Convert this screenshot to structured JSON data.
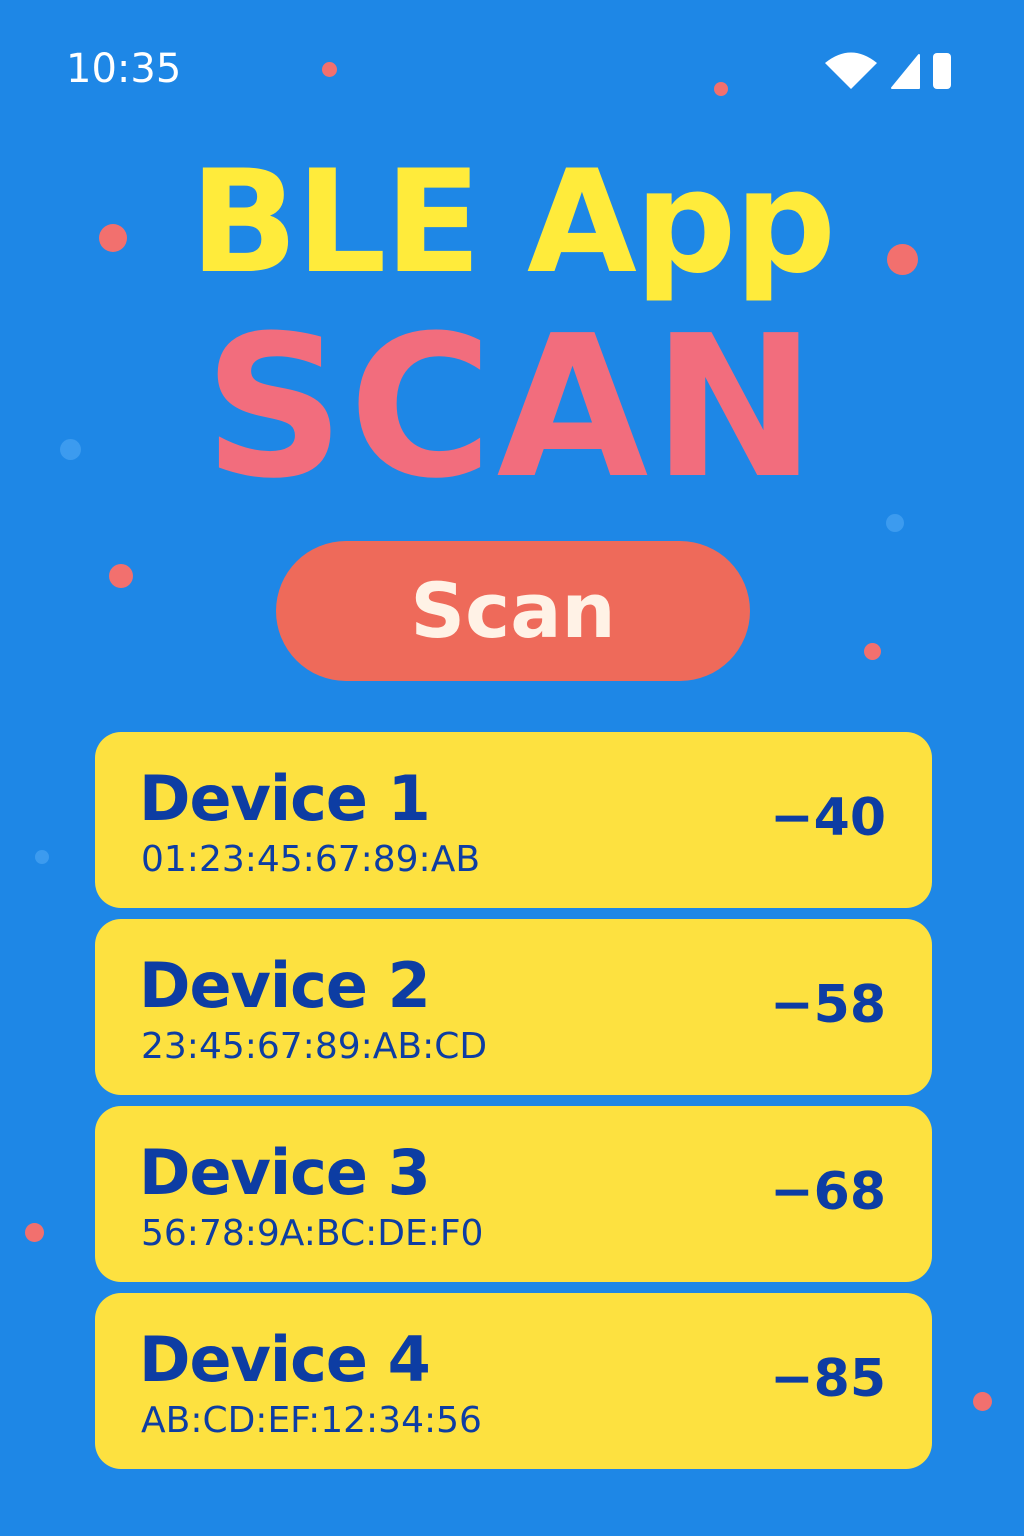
{
  "status_bar": {
    "time": "10:35",
    "icons": [
      "wifi-icon",
      "cellular-signal-icon",
      "battery-icon"
    ]
  },
  "header": {
    "app_title": "BLE App",
    "scan_title": "SCAN"
  },
  "scan_button": {
    "label": "Scan"
  },
  "devices": [
    {
      "name": "Device 1",
      "address": "01:23:45:67:89:AB",
      "rssi": "−40"
    },
    {
      "name": "Device 2",
      "address": "23:45:67:89:AB:CD",
      "rssi": "−58"
    },
    {
      "name": "Device 3",
      "address": "56:78:9A:BC:DE:F0",
      "rssi": "−68"
    },
    {
      "name": "Device 4",
      "address": "AB:CD:EF:12:34:56",
      "rssi": "−85"
    }
  ],
  "colors": {
    "background": "#1E87E6",
    "app_title": "#FFEB3B",
    "scan_title": "#F26D7D",
    "button": "#EE6A5A",
    "card": "#FDE140",
    "card_text": "#0D3DA3"
  }
}
